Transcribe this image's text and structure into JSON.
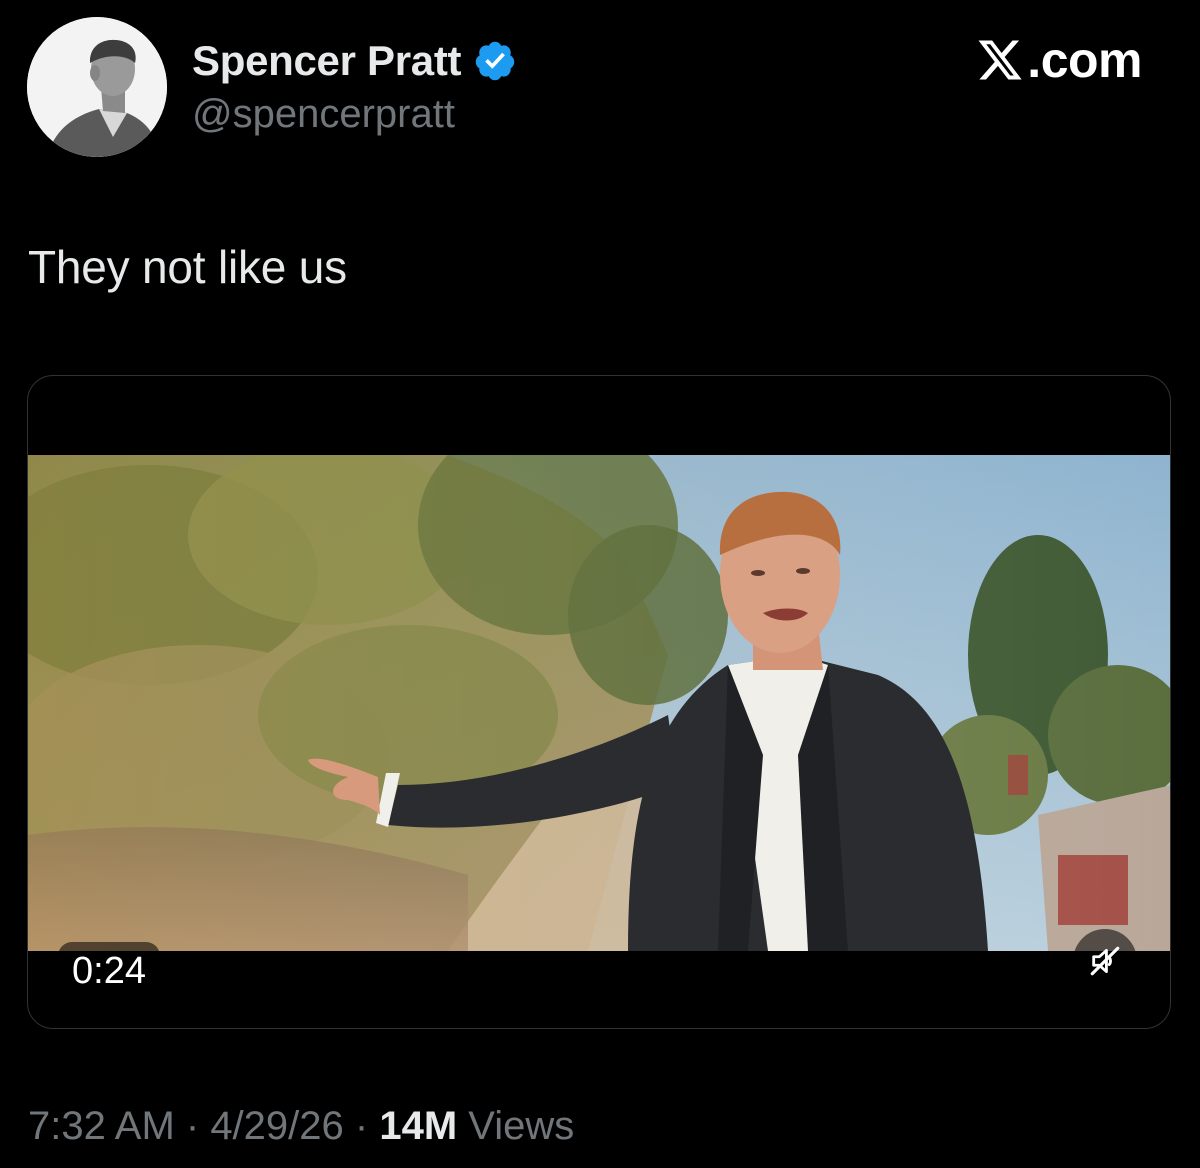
{
  "author": {
    "display_name": "Spencer Pratt",
    "handle": "@spencerpratt",
    "verified": true,
    "verified_color": "#1d9bf0"
  },
  "brand": {
    "label": ".com",
    "icon": "x-logo-icon"
  },
  "tweet": {
    "text": "They not like us"
  },
  "media": {
    "type": "video",
    "duration": "0:24",
    "mute_icon": "muted-speaker-icon"
  },
  "meta": {
    "time": "7:32 AM",
    "sep1": " · ",
    "date": "4/29/26",
    "sep2": " · ",
    "views_count": "14M",
    "views_label": " Views"
  },
  "colors": {
    "background": "#000000",
    "primary_text": "#e7e9ea",
    "secondary_text": "#71767b",
    "border": "#2f3336"
  }
}
